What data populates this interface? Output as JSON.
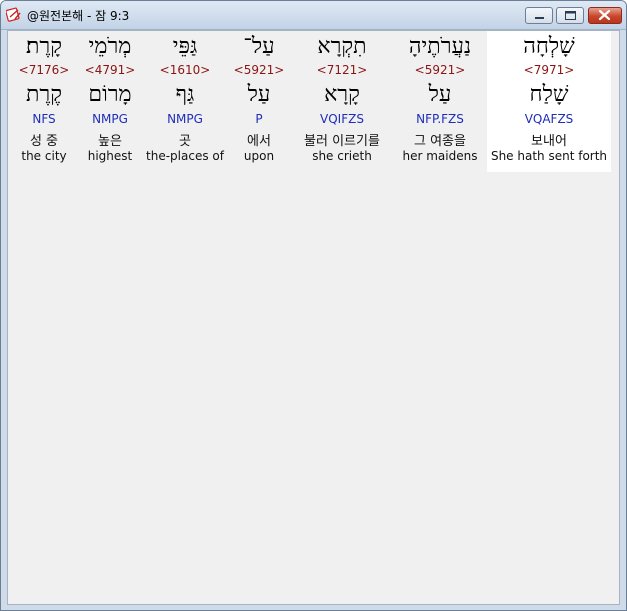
{
  "window": {
    "title": "@원전본해 - 잠 9:3"
  },
  "words": [
    {
      "hebrew": "שָׁלְחָה",
      "strong": "<7971>",
      "lemma": "שָׁלַח",
      "morph": "VQAFZS",
      "korean": "보내어",
      "english": "She hath sent forth"
    },
    {
      "hebrew": "נַעֲרֹתֶיהָ",
      "strong": "<5921>",
      "lemma": "עַל",
      "morph": "NFP.FZS",
      "korean": "그 여종을",
      "english": "her maidens"
    },
    {
      "hebrew": "תִקְרָא",
      "strong": "<7121>",
      "lemma": "קָרָא",
      "morph": "VQIFZS",
      "korean": "불러 이르기를",
      "english": "she crieth"
    },
    {
      "hebrew": "עַל־",
      "strong": "<5921>",
      "lemma": "עַל",
      "morph": "P",
      "korean": "에서",
      "english": "upon"
    },
    {
      "hebrew": "גַּפֵּי",
      "strong": "<1610>",
      "lemma": "גַּף",
      "morph": "NMPG",
      "korean": "곳",
      "english": "the-places of"
    },
    {
      "hebrew": "מְרֹמֵי",
      "strong": "<4791>",
      "lemma": "מָרוֹם",
      "morph": "NMPG",
      "korean": "높은",
      "english": "highest"
    },
    {
      "hebrew": "קָרֶת׃",
      "strong": "<7176>",
      "lemma": "קֶרֶת",
      "morph": "NFS",
      "korean": "성 중",
      "english": "the city"
    }
  ]
}
